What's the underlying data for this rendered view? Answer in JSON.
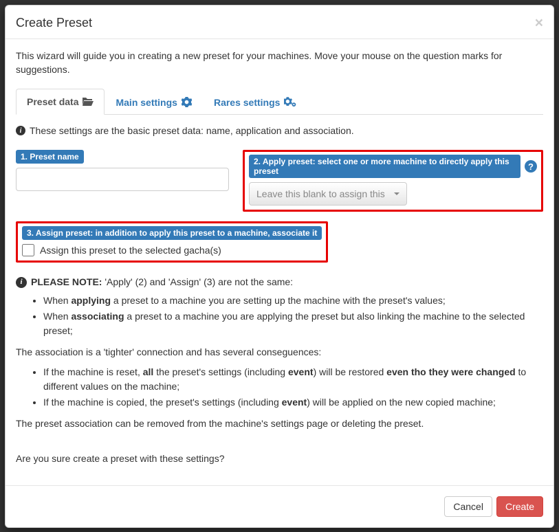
{
  "modal": {
    "title": "Create Preset",
    "intro": "This wizard will guide you in creating a new preset for your machines. Move your mouse on the question marks for suggestions."
  },
  "tabs": [
    {
      "label": "Preset data"
    },
    {
      "label": "Main settings"
    },
    {
      "label": "Rares settings"
    }
  ],
  "info_line": "These settings are the basic preset data: name, application and association.",
  "form": {
    "preset_name_label": "1. Preset name",
    "preset_name_value": "",
    "apply_label": "2. Apply preset: select one or more machine to directly apply this preset",
    "apply_placeholder": "Leave this blank to assign this",
    "assign_label": "3. Assign preset: in addition to apply this preset to a machine, associate it",
    "assign_checkbox_label": "Assign this preset to the selected gacha(s)",
    "assign_checked": false
  },
  "note": {
    "head_strong": "PLEASE NOTE:",
    "head_rest": " 'Apply' (2) and 'Assign' (3) are not the same:",
    "bullets1": {
      "b1_pre": "When ",
      "b1_strong": "applying",
      "b1_post": " a preset to a machine you are setting up the machine with the preset's values;",
      "b2_pre": "When ",
      "b2_strong": "associating",
      "b2_post": " a preset to a machine you are applying the preset but also linking the machine to the selected preset;"
    },
    "assoc_intro": "The association is a 'tighter' connection and has several conseguences:",
    "bullets2": {
      "b1_pre": "If the machine is reset, ",
      "b1_s1": "all",
      "b1_mid": " the preset's settings (including ",
      "b1_s2": "event",
      "b1_mid2": ") will be restored ",
      "b1_s3": "even tho they were changed",
      "b1_post": " to different values on the machine;",
      "b2_pre": "If the machine is copied, the preset's settings (including ",
      "b2_s1": "event",
      "b2_post": ") will be applied on the new copied machine;"
    },
    "removal": "The preset association can be removed from the machine's settings page or deleting the preset.",
    "confirm": "Are you sure create a preset with these settings?"
  },
  "footer": {
    "cancel": "Cancel",
    "create": "Create"
  }
}
